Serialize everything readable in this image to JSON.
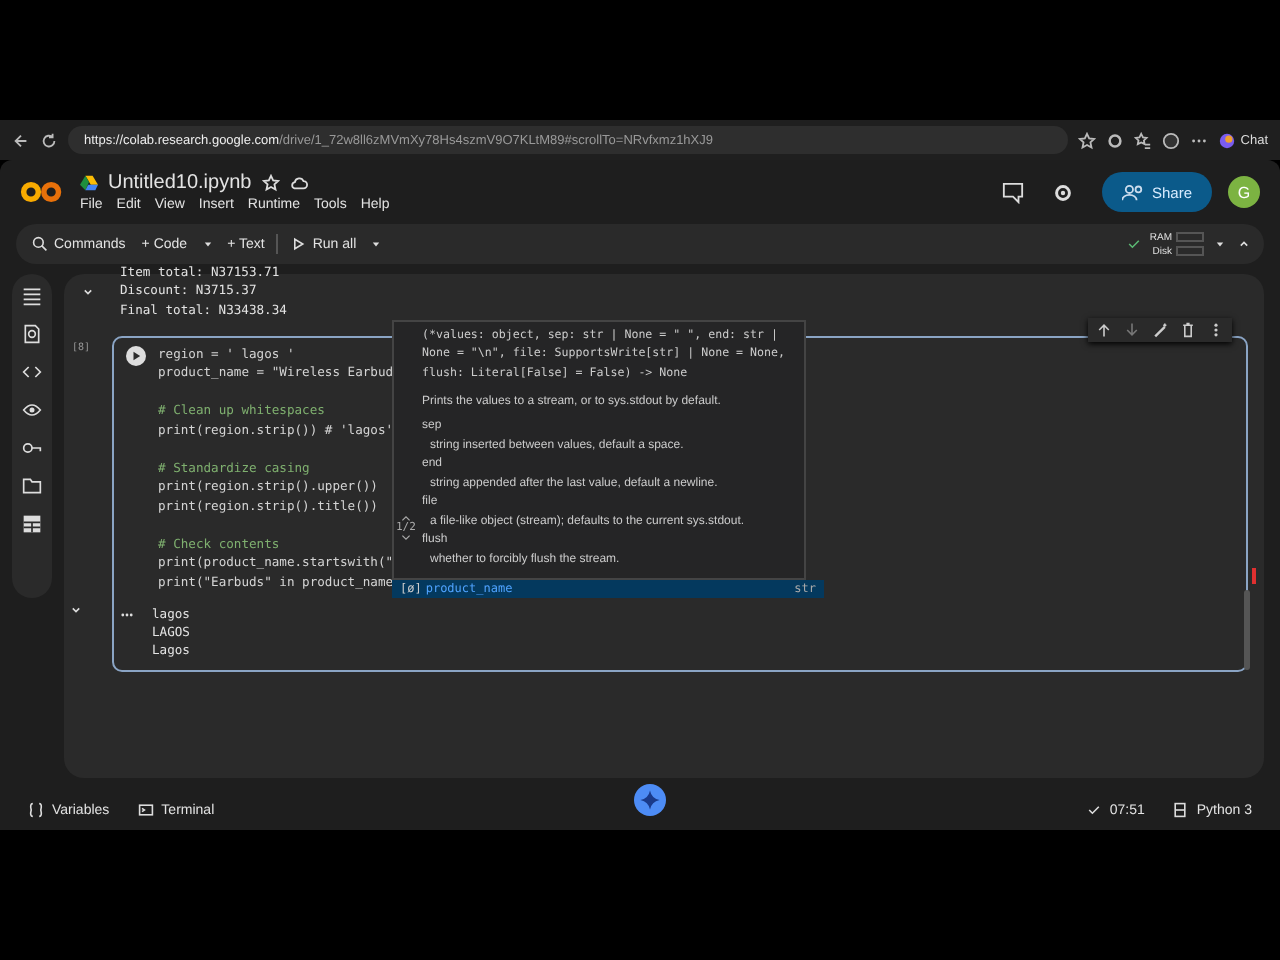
{
  "browser": {
    "url_host": "https://colab.research.google.com",
    "url_path": "/drive/1_72w8ll6zMVmXy78Hs4szmV9O7KLtM89#scrollTo=NRvfxmz1hXJ9",
    "chat": "Chat"
  },
  "notebook": {
    "title": "Untitled10.ipynb",
    "menu": [
      "File",
      "Edit",
      "View",
      "Insert",
      "Runtime",
      "Tools",
      "Help"
    ],
    "share": "Share",
    "avatar": "G"
  },
  "toolbar": {
    "commands": "Commands",
    "code": "+ Code",
    "text": "+ Text",
    "run_all": "Run all",
    "ram": "RAM",
    "disk": "Disk"
  },
  "sidebar": [
    {
      "kind": "toc"
    },
    {
      "kind": "search"
    },
    {
      "kind": "code"
    },
    {
      "kind": "variables"
    },
    {
      "kind": "key"
    },
    {
      "kind": "folder"
    },
    {
      "kind": "table"
    }
  ],
  "prev_output": [
    "Item total: N37153.71",
    "Discount: N3715.37",
    "Final total: N33438.34"
  ],
  "cell": {
    "exec_count": "[8]",
    "code": [
      [
        "region = ' lagos '",
        "product_name = \"Wireless Earbud"
      ],
      [
        "# Clean up whitespaces",
        "print(region.strip()) # 'lagos'"
      ],
      [
        "# Standardize casing",
        "print(region.strip().upper())",
        "print(region.strip().title())"
      ],
      [
        "# Check contents",
        "print(product_name.startswith(\"",
        "print(\"Earbuds\" in product_name"
      ]
    ],
    "output": [
      "lagos",
      "LAGOS",
      "Lagos"
    ]
  },
  "popup": {
    "signature": [
      "(*values: object, sep: str | None = \" \", end: str |",
      "None = \"\\n\", file: SupportsWrite[str] | None = None,",
      "flush: Literal[False] = False) -> None"
    ],
    "doc": "Prints the values to a stream, or to sys.stdout by default.",
    "params": [
      {
        "name": "sep",
        "desc": "string inserted between values, default a space."
      },
      {
        "name": "end",
        "desc": "string appended after the last value, default a newline."
      },
      {
        "name": "file",
        "desc": "a file-like object (stream); defaults to the current sys.stdout."
      },
      {
        "name": "flush",
        "desc": "whether to forcibly flush the stream."
      }
    ],
    "pager": "1/2",
    "suggestion": {
      "icon": "[ø]",
      "name": "product_name",
      "type": "str",
      "selected": true
    }
  },
  "status": {
    "variables": "Variables",
    "terminal": "Terminal",
    "time": "07:51",
    "runtime": "Python 3"
  }
}
